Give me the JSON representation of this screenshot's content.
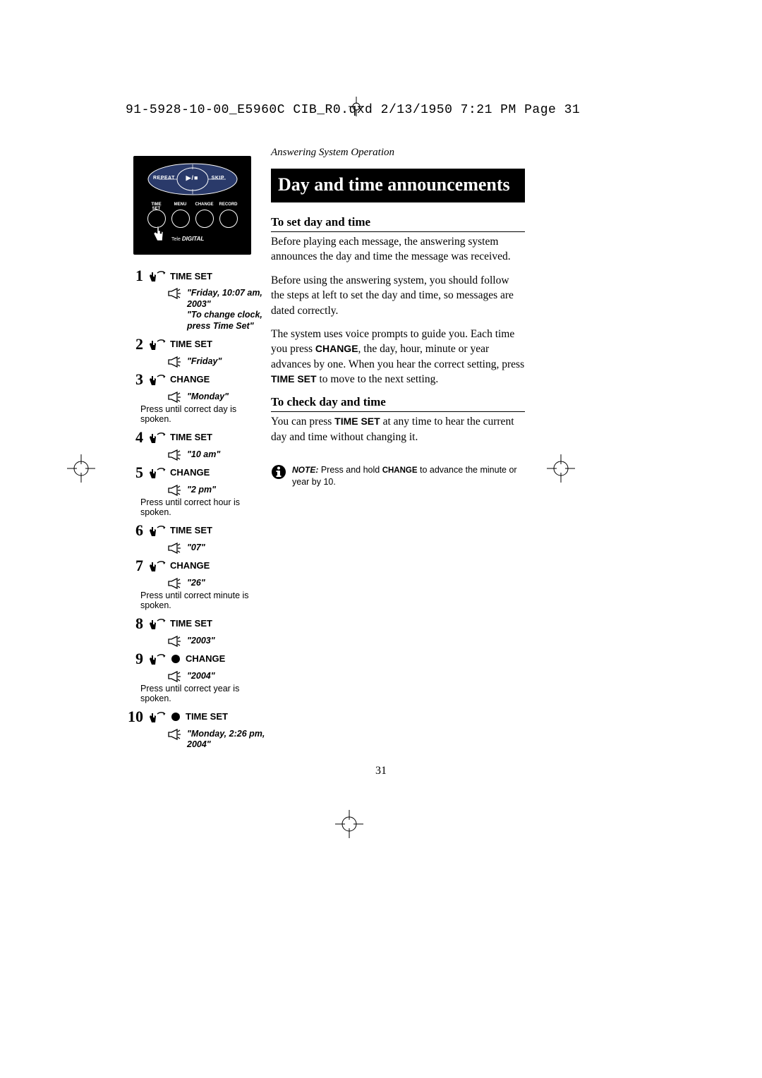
{
  "header": {
    "filepath": "91-5928-10-00_E5960C CIB_R0.qxd  2/13/1950  7:21 PM  Page 31"
  },
  "device": {
    "oval_left": "REPEAT",
    "oval_center": "▶/■",
    "oval_right": "SKIP",
    "circle_labels": [
      "TIME SET",
      "MENU",
      "CHANGE",
      "RECORD"
    ],
    "brand_prefix": "Tele",
    "brand_main": "DIGITAL"
  },
  "steps": [
    {
      "num": "1",
      "button": "TIME SET",
      "voice": "\"Friday, 10:07 am, 2003\"\n\"To change clock,\npress Time Set\"",
      "instr": ""
    },
    {
      "num": "2",
      "button": "TIME SET",
      "voice": "\"Friday\"",
      "instr": ""
    },
    {
      "num": "3",
      "button": "CHANGE",
      "voice": "\"Monday\"",
      "instr": "Press until correct day is spoken."
    },
    {
      "num": "4",
      "button": "TIME SET",
      "voice": "\"10 am\"",
      "instr": ""
    },
    {
      "num": "5",
      "button": "CHANGE",
      "voice": "\"2 pm\"",
      "instr": "Press until correct hour is spoken."
    },
    {
      "num": "6",
      "button": "TIME SET",
      "voice": "\"07\"",
      "instr": ""
    },
    {
      "num": "7",
      "button": "CHANGE",
      "voice": "\"26\"",
      "instr": "Press until correct minute is spoken."
    },
    {
      "num": "8",
      "button": "TIME SET",
      "voice": "\"2003\"",
      "instr": ""
    },
    {
      "num": "9",
      "button": "CHANGE",
      "voice": "\"2004\"",
      "instr": "Press until correct year is spoken.",
      "stop": true
    },
    {
      "num": "10",
      "button": "TIME SET",
      "voice": "\"Monday, 2:26 pm, 2004\"",
      "instr": "",
      "stop": true
    }
  ],
  "right": {
    "breadcrumb": "Answering System Operation",
    "title": "Day and time announcements",
    "sub1": "To set day and time",
    "p1": "Before playing each message, the answering system announces the day and time the message was received.",
    "p2": "Before using the answering system, you should follow the steps at left to set the day and time, so messages are dated correctly.",
    "p3a": "The system uses voice prompts to guide you. Each time you press ",
    "p3b": "CHANGE",
    "p3c": ", the day, hour, minute or year advances by one. When you hear the correct setting, press ",
    "p3d": "TIME SET",
    "p3e": " to move to the next setting.",
    "sub2": "To check day and time",
    "p4a": "You can press ",
    "p4b": "TIME SET",
    "p4c": " at any time to hear the current day and time without changing it.",
    "note_label": "NOTE:",
    "note_a": " Press and hold ",
    "note_b": "CHANGE",
    "note_c": " to advance the minute or year by 10."
  },
  "page_number": "31"
}
